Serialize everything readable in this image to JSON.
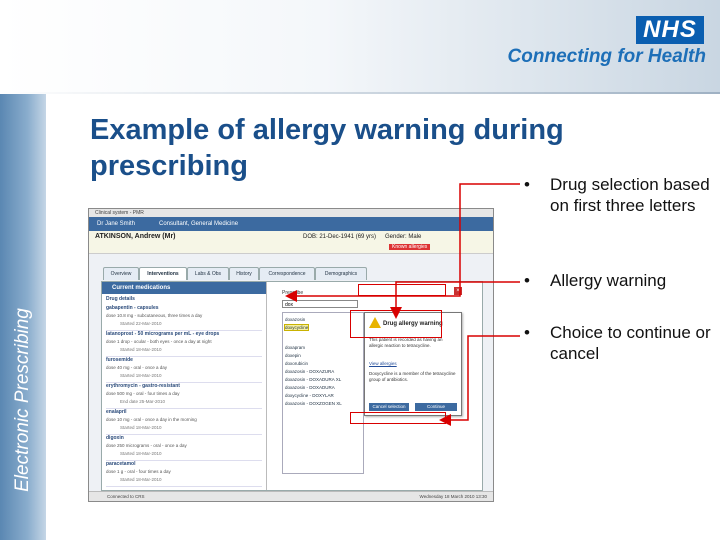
{
  "header": {
    "logo": "NHS",
    "tagline": "Connecting for Health"
  },
  "sidebar": {
    "label": "Electronic Prescribing"
  },
  "slide": {
    "title_line1": "Example of allergy warning during",
    "title_line2": "prescribing"
  },
  "bullets": [
    {
      "marker": "•",
      "text": "Drug selection based on first three letters"
    },
    {
      "marker": "•",
      "text": "Allergy warning"
    },
    {
      "marker": "•",
      "text": "Choice to continue or cancel"
    }
  ],
  "screenshot": {
    "window_title": "Clinical system - PMR",
    "user": "Dr Jane Smith",
    "role": "Consultant, General Medicine",
    "patient_name": "ATKINSON, Andrew (Mr)",
    "dob": "DOB: 21-Dec-1941 (69 yrs)",
    "gender": "Gender: Male",
    "allergy_badge": "Known allergies",
    "tabs": [
      "Overview",
      "Interventions",
      "Labs & Obs",
      "History",
      "Correspondence",
      "Demographics"
    ],
    "current_meds_header": "Current medications",
    "drug_details_label": "Drug details",
    "drugs": [
      {
        "name": "gabapentin - capsules",
        "line1": "dose 10.8 mg - subcutaneous, three times a day",
        "line2": "Started 22-Mar-2010"
      },
      {
        "name": "latanoprost - 50 micrograms per mL - eye drops",
        "line1": "dose 1 drop - ocular - both eyes - once a day at night",
        "line2": "Started 18-Mar-2010"
      },
      {
        "name": "furosemide",
        "line1": "dose 40 mg - oral - once a day",
        "line2": "Started 18-Mar-2010"
      },
      {
        "name": "erythromycin - gastro-resistant",
        "line1": "dose 500 mg - oral - four times a day",
        "line2": "End date 25-Mar-2010"
      },
      {
        "name": "enalapril",
        "line1": "dose 10 mg - oral - once a day in the morning",
        "line2": "Started 18-Mar-2010"
      },
      {
        "name": "digoxin",
        "line1": "dose 250 micrograms - oral - once a day",
        "line2": "Started 18-Mar-2010"
      },
      {
        "name": "paracetamol",
        "line1": "dose 1 g - oral - four times a day",
        "line2": "Started 18-Mar-2010"
      }
    ],
    "prescribe_label": "Prescribe",
    "search_value": "dox",
    "search_results": [
      "doxazosin",
      "doxycycline",
      "doxapram",
      "doxepin",
      "doxorubicin",
      "doxazosin - DOXAZURA",
      "doxazosin - DOXADURA XL",
      "doxazosin - DOXADURA",
      "doxycycline - DOXYLAR",
      "doxazosin - DOXZOGEN XL"
    ],
    "alert_title": "Drug allergy warning",
    "alert_text": "This patient is recorded as having an allergic reaction to tetracycline.",
    "alert_text2": "Doxycycline is a member of the tetracycline group of antibiotics.",
    "alert_link": "View allergies",
    "alert_cancel": "Cancel selection",
    "alert_continue": "Continue",
    "status_left": "Connected to CRS",
    "status_right": "Wednesday 18 March 2010 13:30"
  },
  "colors": {
    "title": "#1a4f8a",
    "callout": "#d80000",
    "nhs_blue": "#0a5eb0"
  }
}
